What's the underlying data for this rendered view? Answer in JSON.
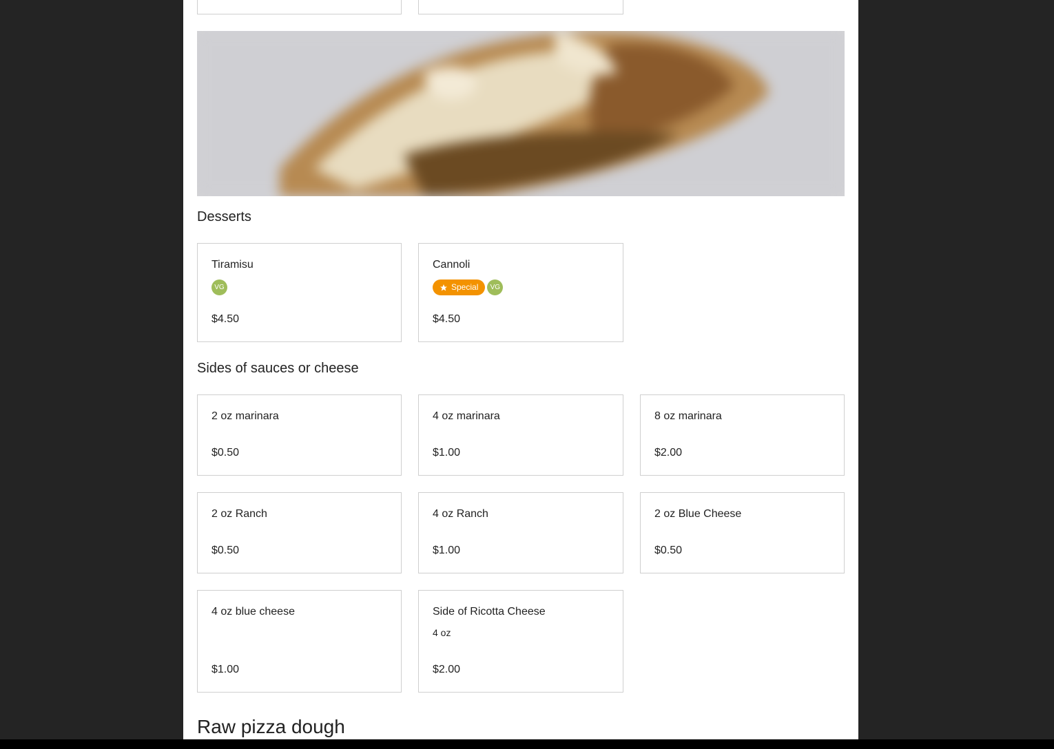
{
  "sections": [
    {
      "title": "Desserts",
      "items": [
        {
          "name": "Tiramisu",
          "price": "$4.50",
          "special": false,
          "special_label": "",
          "vg_label": "VG"
        },
        {
          "name": "Cannoli",
          "price": "$4.50",
          "special": true,
          "special_label": "Special",
          "vg_label": "VG"
        }
      ]
    },
    {
      "title": "Sides of sauces or cheese",
      "items": [
        {
          "name": "2 oz marinara",
          "price": "$0.50"
        },
        {
          "name": "4 oz marinara",
          "price": "$1.00"
        },
        {
          "name": "8 oz marinara",
          "price": "$2.00"
        },
        {
          "name": "2 oz Ranch",
          "price": "$0.50"
        },
        {
          "name": "4 oz Ranch",
          "price": "$1.00"
        },
        {
          "name": "2 oz Blue Cheese",
          "price": "$0.50"
        },
        {
          "name": "4 oz blue cheese",
          "price": "$1.00"
        },
        {
          "name": "Side of Ricotta Cheese",
          "description": "4 oz",
          "price": "$2.00"
        }
      ]
    },
    {
      "title": "Raw pizza dough",
      "items": []
    }
  ],
  "colors": {
    "vg_badge": "#9fbd5a",
    "special_badge": "#f39200",
    "backdrop": "#242424"
  },
  "icons": {
    "special": "star-icon"
  }
}
